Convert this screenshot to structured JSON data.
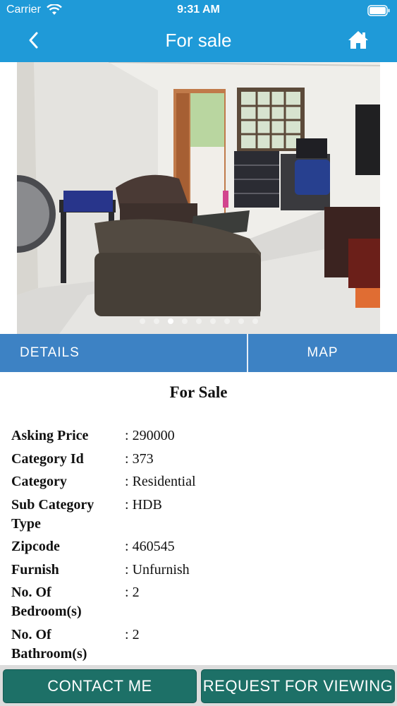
{
  "status_bar": {
    "carrier": "Carrier",
    "time": "9:31 AM"
  },
  "nav": {
    "title": "For sale",
    "back_icon": "chevron-left-icon",
    "home_icon": "home-icon"
  },
  "photo": {
    "dots_total": 9,
    "active_index": 2
  },
  "tabs": {
    "details": "DETAILS",
    "map": "MAP"
  },
  "section_title": "For Sale",
  "details": [
    {
      "label": "Asking Price",
      "value": "290000"
    },
    {
      "label": "Category Id",
      "value": "373"
    },
    {
      "label": "Category",
      "value": "Residential"
    },
    {
      "label": "Sub Category Type",
      "value": "HDB"
    },
    {
      "label": "Zipcode",
      "value": "460545"
    },
    {
      "label": "Furnish",
      "value": "Unfurnish"
    },
    {
      "label": "No. Of Bedroom(s)",
      "value": "2"
    },
    {
      "label": "No. Of Bathroom(s)",
      "value": "2"
    }
  ],
  "buttons": {
    "contact": "CONTACT ME",
    "viewing": "REQUEST FOR VIEWING"
  },
  "colors": {
    "header": "#1f9ad8",
    "tabs": "#3d82c4",
    "button": "#1d7067"
  }
}
